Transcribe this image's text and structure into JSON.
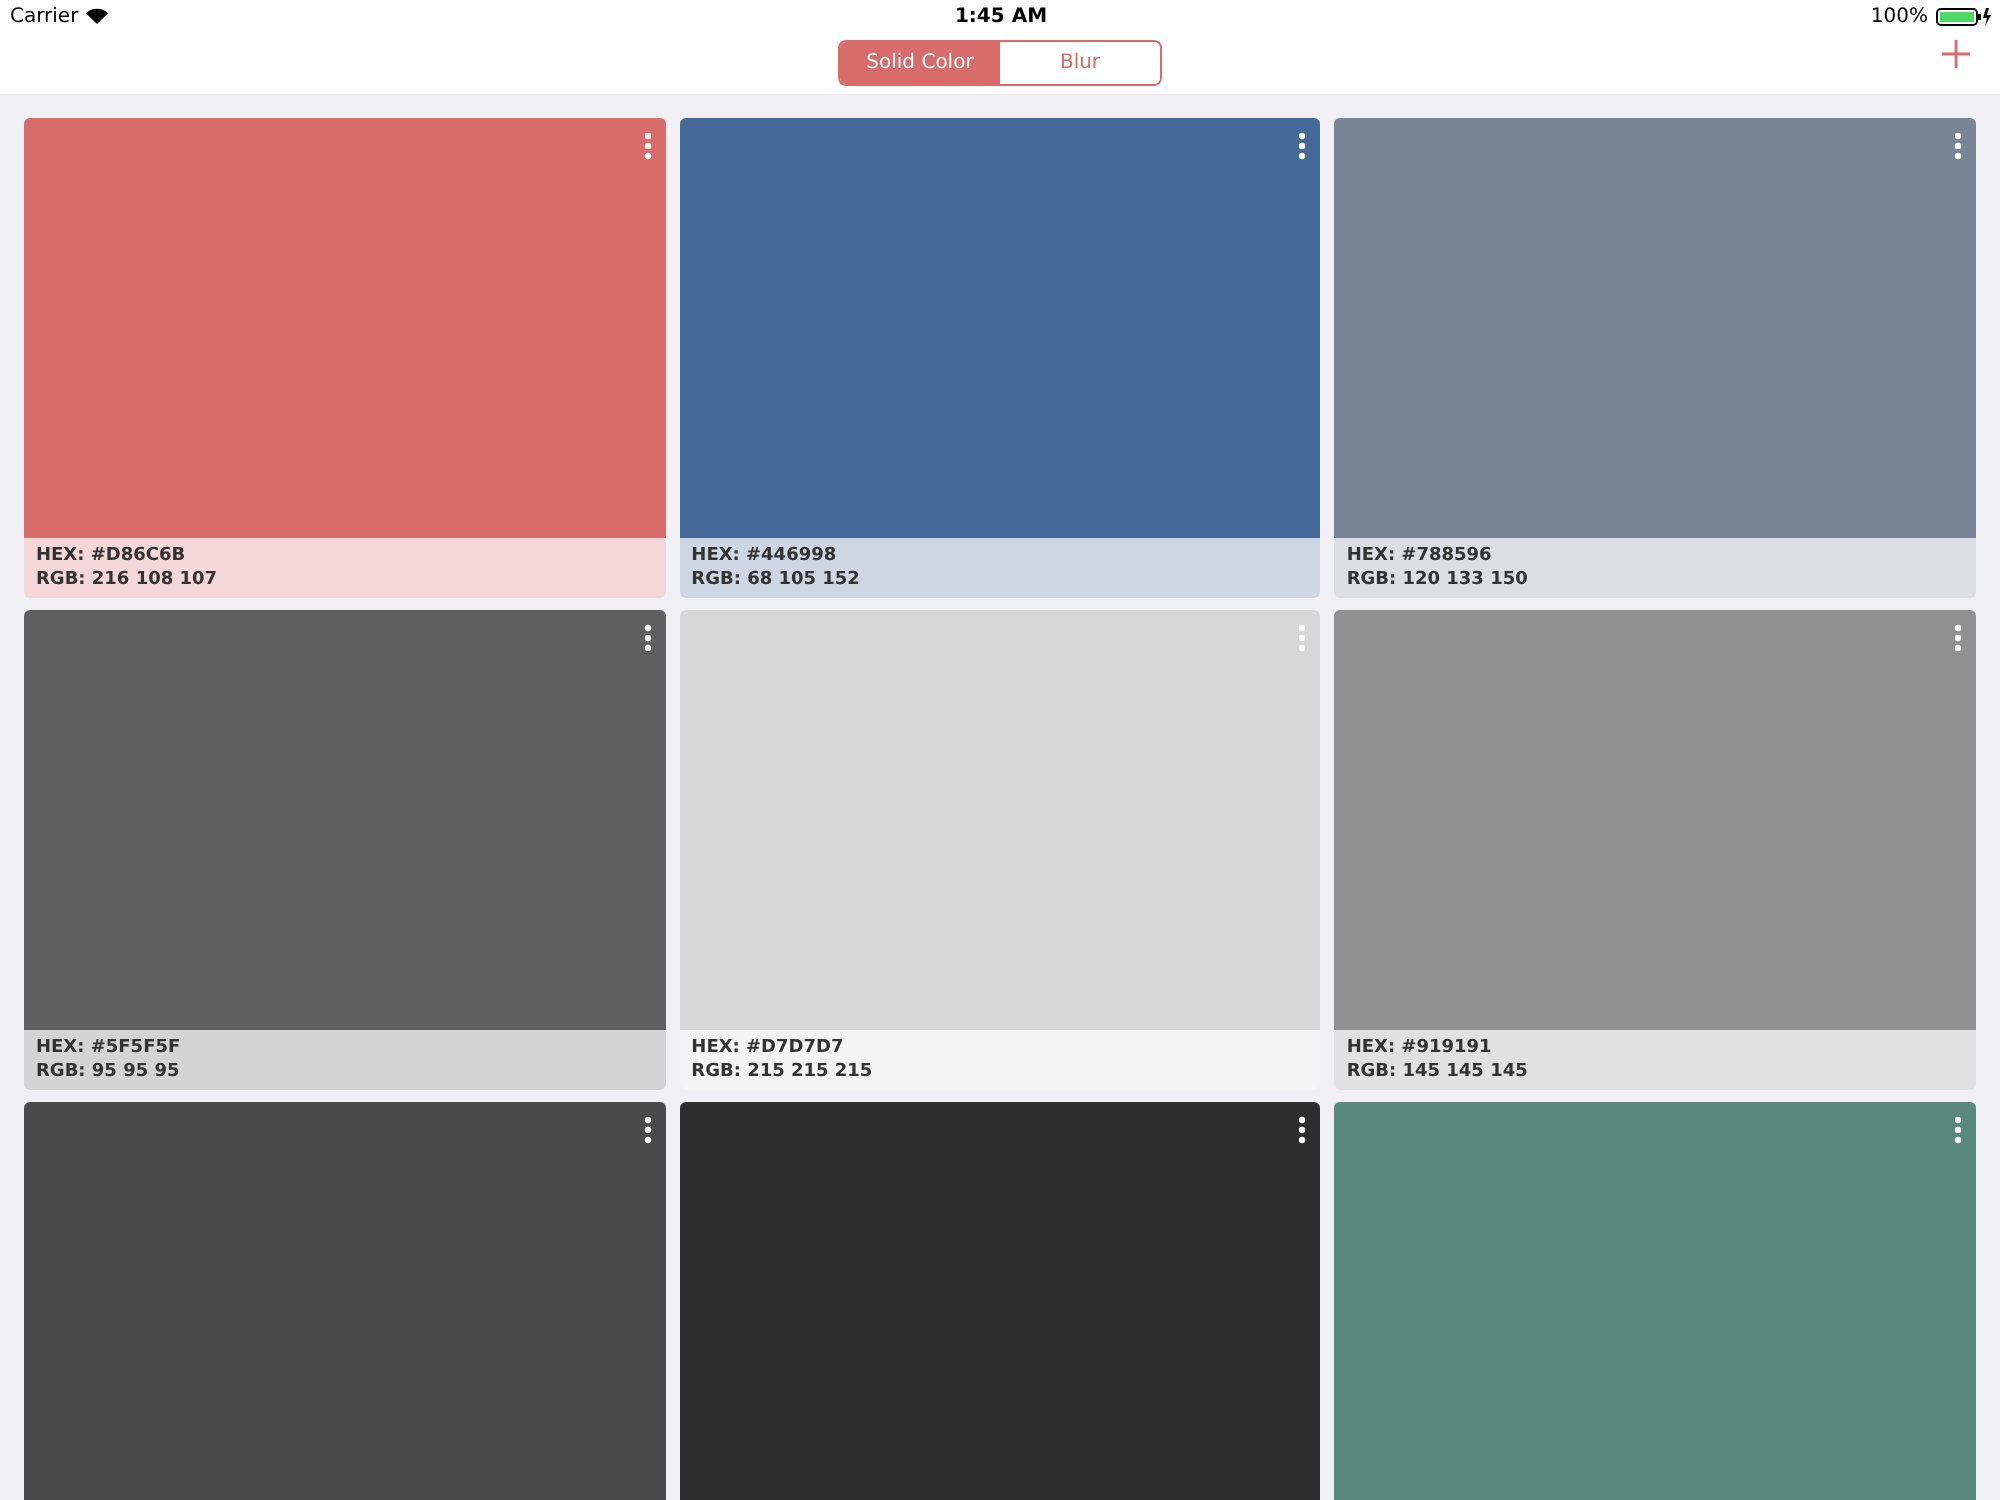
{
  "status_bar": {
    "carrier": "Carrier",
    "time": "1:45 AM",
    "battery": "100%"
  },
  "segments": [
    {
      "label": "Solid Color",
      "selected": true
    },
    {
      "label": "Blur",
      "selected": false
    }
  ],
  "swatches": [
    {
      "color": "#d86c6b",
      "hex": "HEX: #D86C6B",
      "rgb": "RGB: 216 108 107"
    },
    {
      "color": "#446998",
      "hex": "HEX: #446998",
      "rgb": "RGB: 68 105 152"
    },
    {
      "color": "#788596",
      "hex": "HEX: #788596",
      "rgb": "RGB: 120 133 150"
    },
    {
      "color": "#5f5f5f",
      "hex": "HEX: #5F5F5F",
      "rgb": "RGB: 95 95 95"
    },
    {
      "color": "#d7d7d7",
      "hex": "HEX: #D7D7D7",
      "rgb": "RGB: 215 215 215"
    },
    {
      "color": "#919191",
      "hex": "HEX: #919191",
      "rgb": "RGB: 145 145 145"
    },
    {
      "color": "#4a4a4a"
    },
    {
      "color": "#2d2d2d"
    },
    {
      "color": "#58877b"
    }
  ]
}
